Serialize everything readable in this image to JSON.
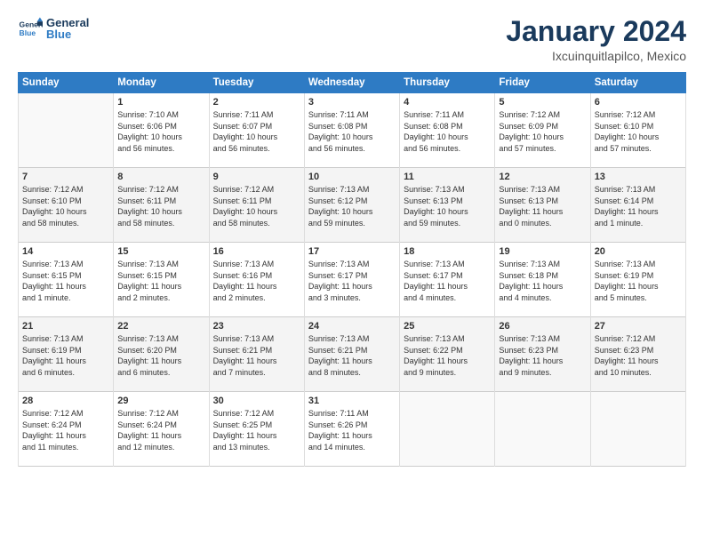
{
  "logo": {
    "general": "General",
    "blue": "Blue"
  },
  "title": "January 2024",
  "location": "Ixcuinquitlapilco, Mexico",
  "weekdays": [
    "Sunday",
    "Monday",
    "Tuesday",
    "Wednesday",
    "Thursday",
    "Friday",
    "Saturday"
  ],
  "weeks": [
    [
      {
        "day": "",
        "info": ""
      },
      {
        "day": "1",
        "info": "Sunrise: 7:10 AM\nSunset: 6:06 PM\nDaylight: 10 hours\nand 56 minutes."
      },
      {
        "day": "2",
        "info": "Sunrise: 7:11 AM\nSunset: 6:07 PM\nDaylight: 10 hours\nand 56 minutes."
      },
      {
        "day": "3",
        "info": "Sunrise: 7:11 AM\nSunset: 6:08 PM\nDaylight: 10 hours\nand 56 minutes."
      },
      {
        "day": "4",
        "info": "Sunrise: 7:11 AM\nSunset: 6:08 PM\nDaylight: 10 hours\nand 56 minutes."
      },
      {
        "day": "5",
        "info": "Sunrise: 7:12 AM\nSunset: 6:09 PM\nDaylight: 10 hours\nand 57 minutes."
      },
      {
        "day": "6",
        "info": "Sunrise: 7:12 AM\nSunset: 6:10 PM\nDaylight: 10 hours\nand 57 minutes."
      }
    ],
    [
      {
        "day": "7",
        "info": "Sunrise: 7:12 AM\nSunset: 6:10 PM\nDaylight: 10 hours\nand 58 minutes."
      },
      {
        "day": "8",
        "info": "Sunrise: 7:12 AM\nSunset: 6:11 PM\nDaylight: 10 hours\nand 58 minutes."
      },
      {
        "day": "9",
        "info": "Sunrise: 7:12 AM\nSunset: 6:11 PM\nDaylight: 10 hours\nand 58 minutes."
      },
      {
        "day": "10",
        "info": "Sunrise: 7:13 AM\nSunset: 6:12 PM\nDaylight: 10 hours\nand 59 minutes."
      },
      {
        "day": "11",
        "info": "Sunrise: 7:13 AM\nSunset: 6:13 PM\nDaylight: 10 hours\nand 59 minutes."
      },
      {
        "day": "12",
        "info": "Sunrise: 7:13 AM\nSunset: 6:13 PM\nDaylight: 11 hours\nand 0 minutes."
      },
      {
        "day": "13",
        "info": "Sunrise: 7:13 AM\nSunset: 6:14 PM\nDaylight: 11 hours\nand 1 minute."
      }
    ],
    [
      {
        "day": "14",
        "info": "Sunrise: 7:13 AM\nSunset: 6:15 PM\nDaylight: 11 hours\nand 1 minute."
      },
      {
        "day": "15",
        "info": "Sunrise: 7:13 AM\nSunset: 6:15 PM\nDaylight: 11 hours\nand 2 minutes."
      },
      {
        "day": "16",
        "info": "Sunrise: 7:13 AM\nSunset: 6:16 PM\nDaylight: 11 hours\nand 2 minutes."
      },
      {
        "day": "17",
        "info": "Sunrise: 7:13 AM\nSunset: 6:17 PM\nDaylight: 11 hours\nand 3 minutes."
      },
      {
        "day": "18",
        "info": "Sunrise: 7:13 AM\nSunset: 6:17 PM\nDaylight: 11 hours\nand 4 minutes."
      },
      {
        "day": "19",
        "info": "Sunrise: 7:13 AM\nSunset: 6:18 PM\nDaylight: 11 hours\nand 4 minutes."
      },
      {
        "day": "20",
        "info": "Sunrise: 7:13 AM\nSunset: 6:19 PM\nDaylight: 11 hours\nand 5 minutes."
      }
    ],
    [
      {
        "day": "21",
        "info": "Sunrise: 7:13 AM\nSunset: 6:19 PM\nDaylight: 11 hours\nand 6 minutes."
      },
      {
        "day": "22",
        "info": "Sunrise: 7:13 AM\nSunset: 6:20 PM\nDaylight: 11 hours\nand 6 minutes."
      },
      {
        "day": "23",
        "info": "Sunrise: 7:13 AM\nSunset: 6:21 PM\nDaylight: 11 hours\nand 7 minutes."
      },
      {
        "day": "24",
        "info": "Sunrise: 7:13 AM\nSunset: 6:21 PM\nDaylight: 11 hours\nand 8 minutes."
      },
      {
        "day": "25",
        "info": "Sunrise: 7:13 AM\nSunset: 6:22 PM\nDaylight: 11 hours\nand 9 minutes."
      },
      {
        "day": "26",
        "info": "Sunrise: 7:13 AM\nSunset: 6:23 PM\nDaylight: 11 hours\nand 9 minutes."
      },
      {
        "day": "27",
        "info": "Sunrise: 7:12 AM\nSunset: 6:23 PM\nDaylight: 11 hours\nand 10 minutes."
      }
    ],
    [
      {
        "day": "28",
        "info": "Sunrise: 7:12 AM\nSunset: 6:24 PM\nDaylight: 11 hours\nand 11 minutes."
      },
      {
        "day": "29",
        "info": "Sunrise: 7:12 AM\nSunset: 6:24 PM\nDaylight: 11 hours\nand 12 minutes."
      },
      {
        "day": "30",
        "info": "Sunrise: 7:12 AM\nSunset: 6:25 PM\nDaylight: 11 hours\nand 13 minutes."
      },
      {
        "day": "31",
        "info": "Sunrise: 7:11 AM\nSunset: 6:26 PM\nDaylight: 11 hours\nand 14 minutes."
      },
      {
        "day": "",
        "info": ""
      },
      {
        "day": "",
        "info": ""
      },
      {
        "day": "",
        "info": ""
      }
    ]
  ]
}
